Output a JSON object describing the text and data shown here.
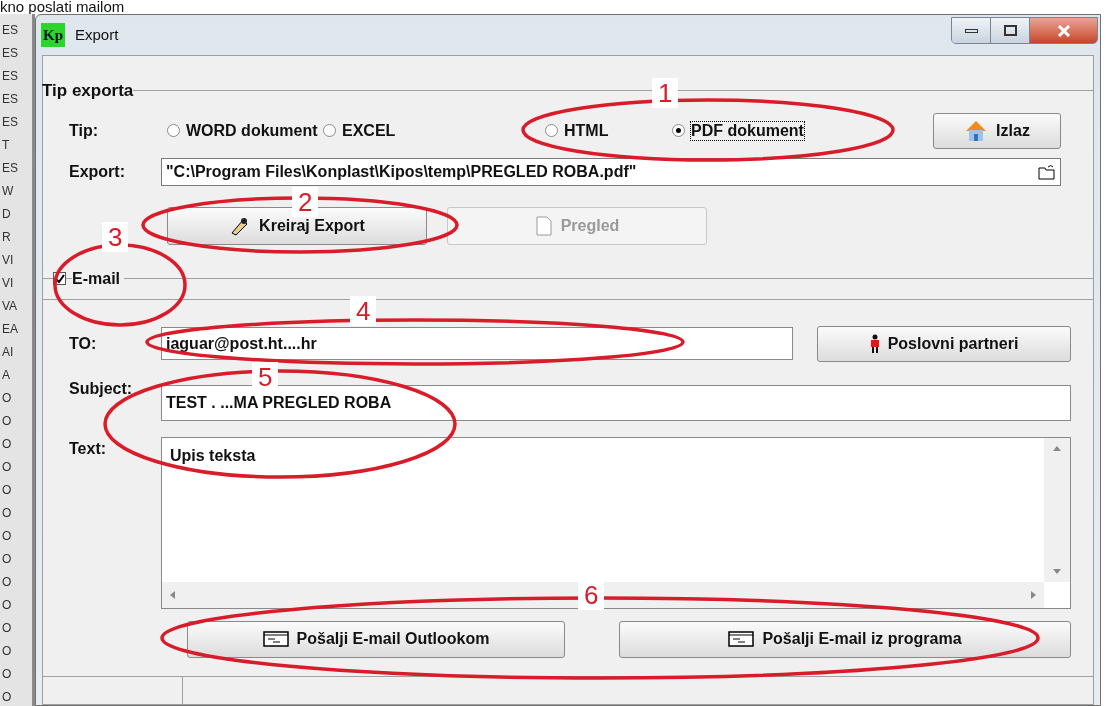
{
  "caption": "kno poslati mailom",
  "background_rows": [
    "ES",
    "ES",
    "ES",
    "ES",
    "ES",
    "T",
    "ES",
    "W",
    "D",
    "R",
    "VI",
    "VI",
    "VA",
    "EA",
    "AI",
    "A",
    "O",
    "O",
    "O",
    "O",
    "O",
    "O",
    "O",
    "O",
    "O",
    "O",
    "O",
    "O",
    "O",
    "O"
  ],
  "window": {
    "icon_text": "Kp",
    "title": "Export"
  },
  "export_group": {
    "title": "Tip exporta",
    "type_label": "Tip:",
    "formats": [
      {
        "label": "WORD dokument",
        "selected": false
      },
      {
        "label": "EXCEL",
        "selected": false
      },
      {
        "label": "HTML",
        "selected": false
      },
      {
        "label": "PDF dokument",
        "selected": true
      }
    ],
    "exit_button": "Izlaz",
    "path_label": "Export:",
    "path": "\"C:\\Program Files\\Konplast\\Kipos\\temp\\PREGLED ROBA.pdf\"",
    "create_button": {
      "label": "Kreiraj Export",
      "disabled": false
    },
    "preview_button": {
      "label": "Pregled",
      "disabled": true
    }
  },
  "email": {
    "label": "E-mail",
    "checked": true,
    "to_label": "TO:",
    "to": "jaguar@post.ht....hr",
    "partners_button": "Poslovni partneri",
    "subject_label": "Subject:",
    "subject": "TEST . ...MA PREGLED ROBA",
    "text_label": "Text:",
    "text": "Upis teksta",
    "send_buttons": [
      "Pošalji E-mail Outlookom",
      "Pošalji E-mail iz programa"
    ]
  },
  "annotations": [
    {
      "number": "1"
    },
    {
      "number": "2"
    },
    {
      "number": "3"
    },
    {
      "number": "4"
    },
    {
      "number": "5"
    },
    {
      "number": "6"
    }
  ]
}
